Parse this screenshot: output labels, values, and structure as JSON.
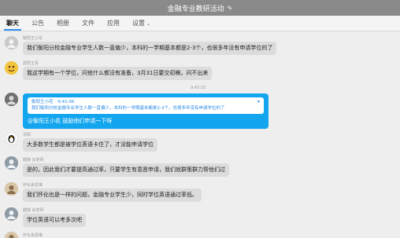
{
  "window": {
    "title": "金融专业教研活动",
    "edit_icon": "pencil-icon"
  },
  "tabs": [
    {
      "label": "聊天",
      "active": true
    },
    {
      "label": "公告"
    },
    {
      "label": "相册"
    },
    {
      "label": "文件"
    },
    {
      "label": "应用"
    },
    {
      "label": "设置",
      "has_dropdown": true
    }
  ],
  "messages": [
    {
      "sender": "衡阳王小花",
      "text": "我们衡阳分校金融专业学生人数一直偏少，本科的一学期基本都是2-3个，也很多年没有申请学位的了"
    },
    {
      "sender": "邵慧玉青",
      "text": "我这学期有一个学位，问他什么都没有准备，3月31日要交初稿，问不出来"
    },
    {
      "timestamp": "9:43:15"
    },
    {
      "quote_sender": "衡阳王小花",
      "quote_time": "9:41:06",
      "quote_text": "我们衡阳分校金融专业学生人数一直偏少，本科的一学期基本都是2-3个，也很多年没有申请学位的了",
      "mention": "@衡阳王小花 鼓励他们申请一下呀"
    },
    {
      "sender": "浏阳",
      "text": "大多数学生都是被学位英语卡住了，才没能申请学位"
    },
    {
      "sender": "醴陵 肖老师",
      "text": "是的，因此我们才要提高通过率，只要学生有意愿申请，我们就群策群力帮他们过"
    },
    {
      "sender": "怀化余爱琳",
      "text": "我们怀化也是一样的问题，金融专业学生少，同时学位英语通过率低。"
    },
    {
      "sender": "醴陵 肖老师",
      "text": "学位英语可以考多次吧"
    },
    {
      "sender": "怀化余爱琳"
    }
  ],
  "colors": {
    "accent": "#2f8ef0",
    "bubble_blue": "#13a6ef",
    "bubble_gray": "#dcdcdc",
    "titlebar": "#8a8a8a"
  }
}
